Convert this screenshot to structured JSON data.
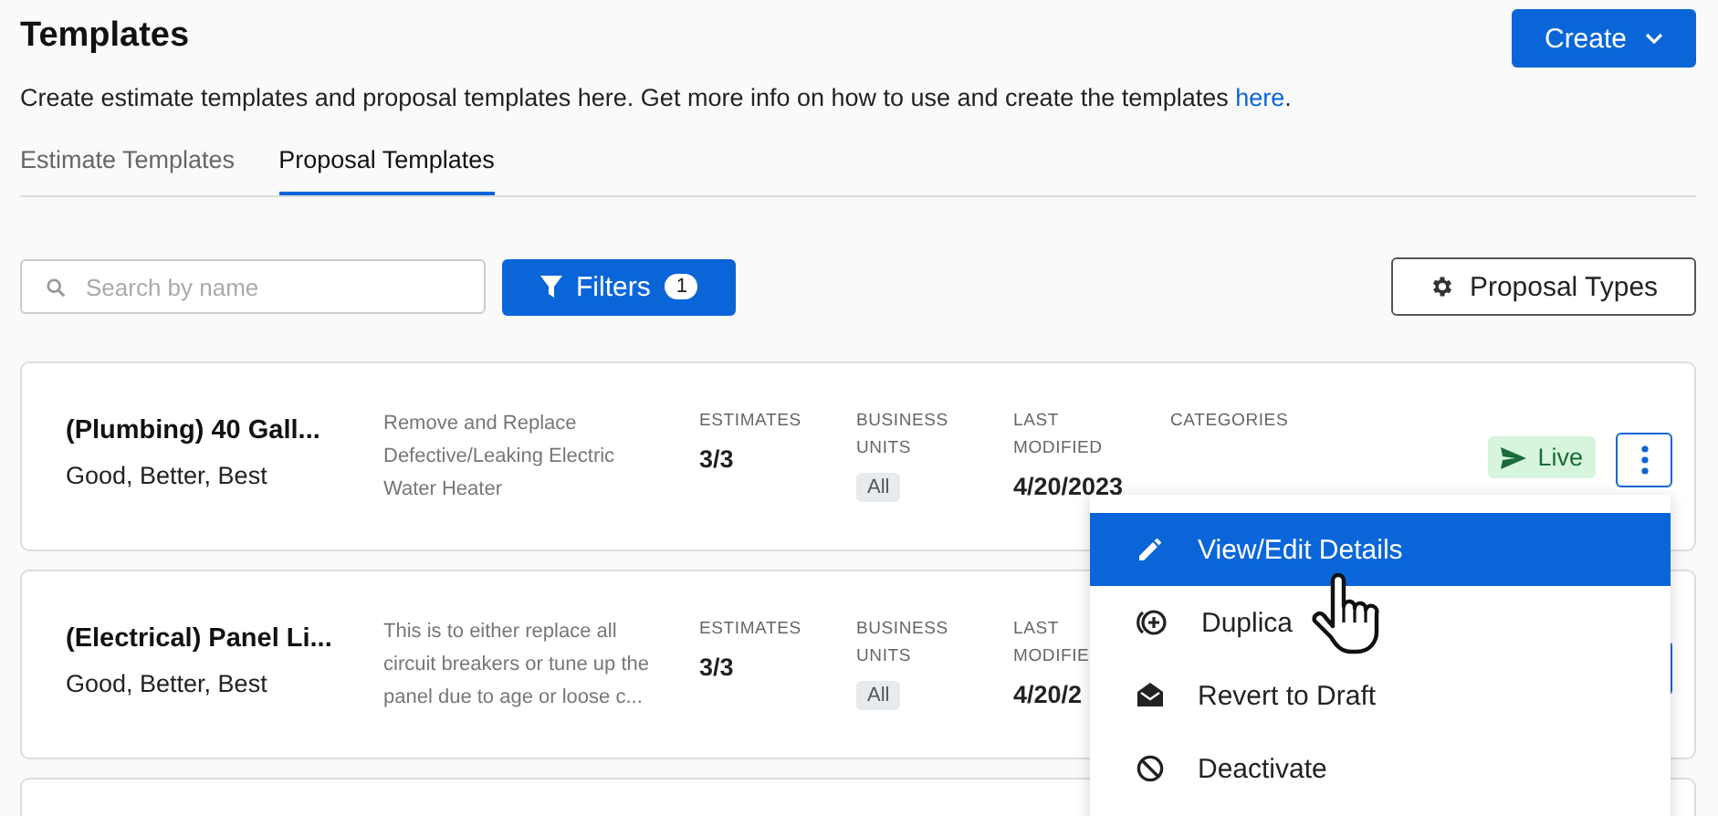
{
  "header": {
    "title": "Templates",
    "create_button": "Create"
  },
  "intro": {
    "text": "Create estimate templates and proposal templates here. Get more info on how to use and create the templates ",
    "link": "here",
    "end": "."
  },
  "tabs": [
    {
      "label": "Estimate Templates",
      "selected": false
    },
    {
      "label": "Proposal Templates",
      "selected": true
    }
  ],
  "search": {
    "placeholder": "Search by name"
  },
  "filters": {
    "label": "Filters",
    "count": "1"
  },
  "proposal_types_button": "Proposal Types",
  "templates": [
    {
      "name": "(Plumbing) 40 Gall...",
      "subtitle": "Good, Better, Best",
      "description": "Remove and Replace Defective/Leaking Electric Water Heater",
      "estimates_label": "ESTIMATES",
      "estimates": "3/3",
      "business_units_label": "BUSINESS UNITS",
      "business_units": "All",
      "last_modified_label": "LAST MODIFIED",
      "last_modified": "4/20/2023",
      "categories_label": "CATEGORIES",
      "status": "Live"
    },
    {
      "name": "(Electrical) Panel Li...",
      "subtitle": "Good, Better, Best",
      "description": "This is to either replace all circuit breakers or tune up the panel due to age or loose c...",
      "estimates_label": "ESTIMATES",
      "estimates": "3/3",
      "business_units_label": "BUSINESS UNITS",
      "business_units": "All",
      "last_modified_label": "LAST MODIFIE",
      "last_modified": "4/20/2"
    }
  ],
  "menu": {
    "items": [
      {
        "label": "View/Edit Details",
        "selected": true
      },
      {
        "label": "Duplica",
        "selected": false
      },
      {
        "label": "Revert to Draft",
        "selected": false
      },
      {
        "label": "Deactivate",
        "selected": false
      }
    ]
  }
}
